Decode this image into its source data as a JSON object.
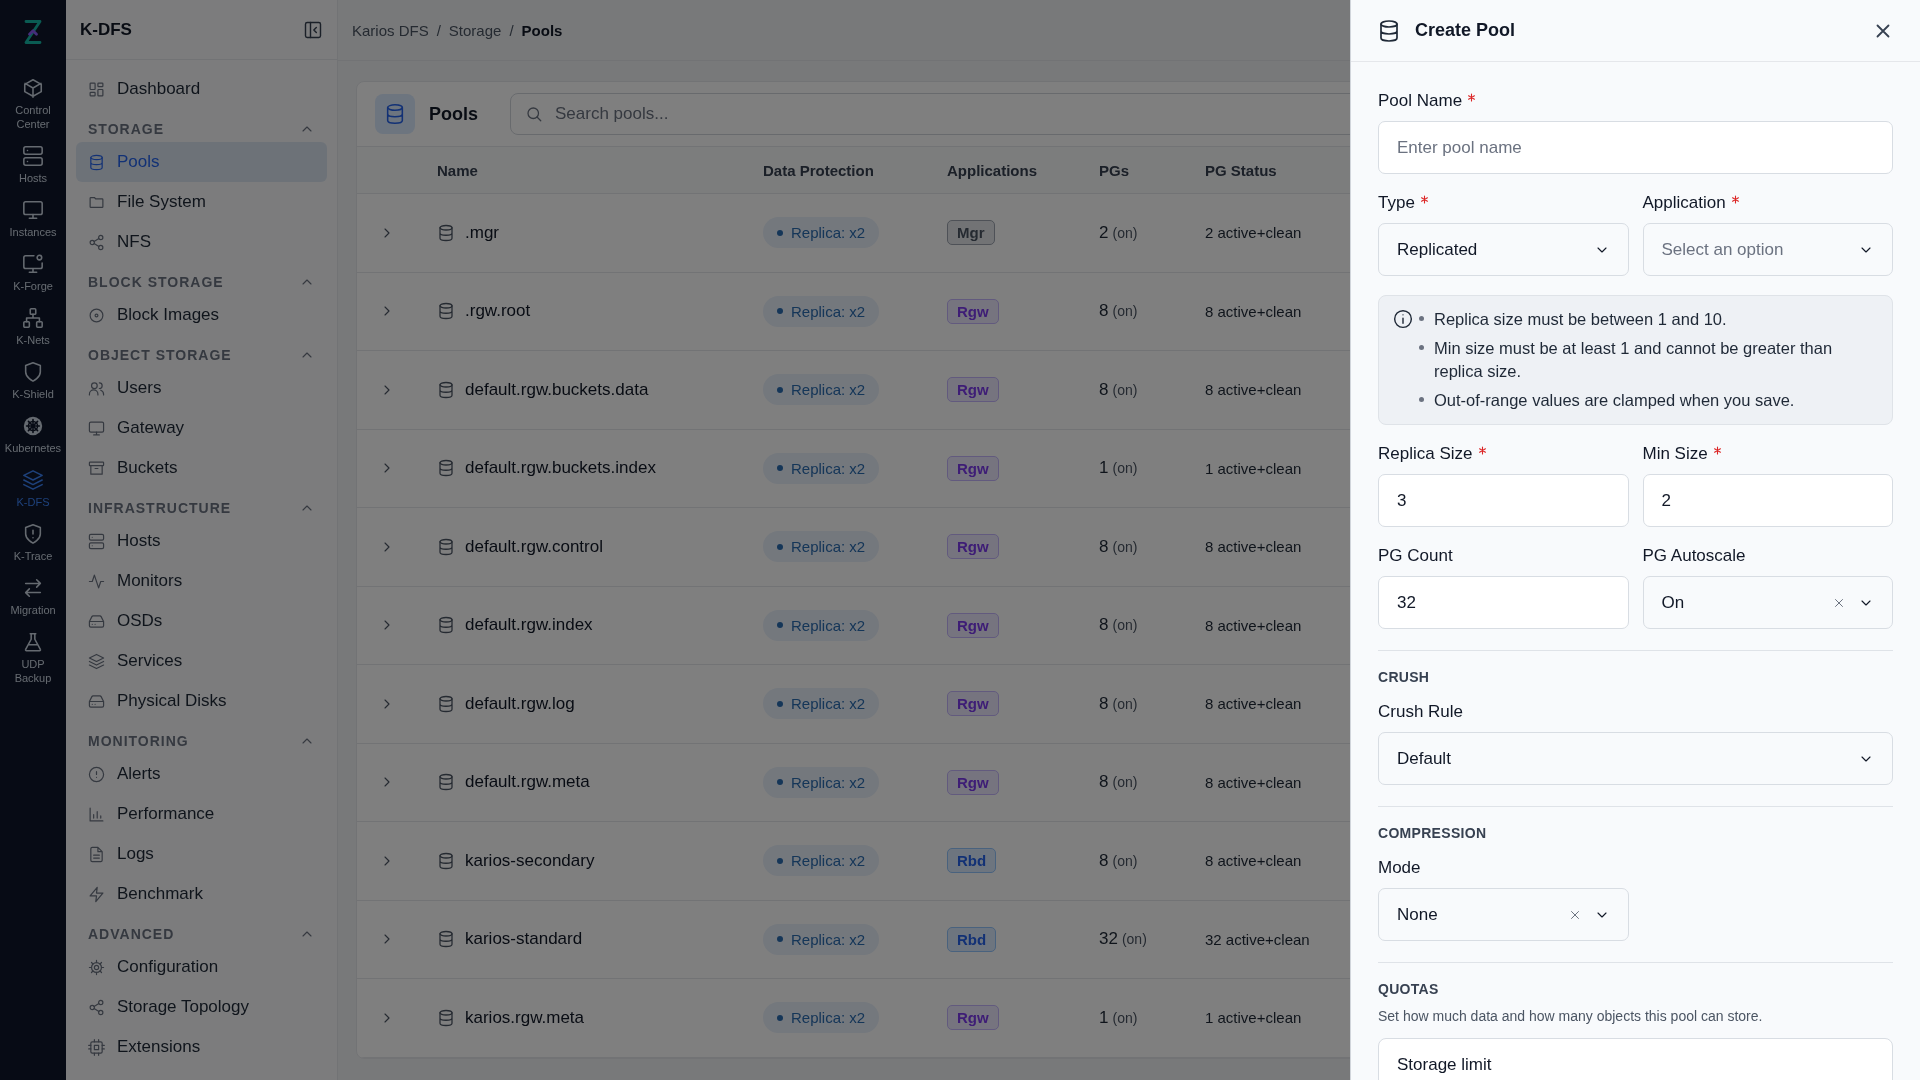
{
  "rail": {
    "items": [
      {
        "label": "Control Center",
        "selected": false
      },
      {
        "label": "Hosts",
        "selected": false
      },
      {
        "label": "Instances",
        "selected": false
      },
      {
        "label": "K-Forge",
        "selected": false
      },
      {
        "label": "K-Nets",
        "selected": false
      },
      {
        "label": "K-Shield",
        "selected": false
      },
      {
        "label": "Kubernetes",
        "selected": false
      },
      {
        "label": "K-DFS",
        "selected": true
      },
      {
        "label": "K-Trace",
        "selected": false
      },
      {
        "label": "Migration",
        "selected": false
      },
      {
        "label": "UDP Backup",
        "selected": false
      }
    ]
  },
  "sidebar": {
    "title": "K-DFS",
    "sections": [
      {
        "items": [
          {
            "label": "Dashboard",
            "selected": false
          }
        ]
      },
      {
        "heading": "STORAGE",
        "expanded": true,
        "items": [
          {
            "label": "Pools",
            "selected": true
          },
          {
            "label": "File System",
            "selected": false
          },
          {
            "label": "NFS",
            "selected": false
          }
        ]
      },
      {
        "heading": "BLOCK STORAGE",
        "expanded": true,
        "items": [
          {
            "label": "Block Images",
            "selected": false
          }
        ]
      },
      {
        "heading": "OBJECT STORAGE",
        "expanded": true,
        "items": [
          {
            "label": "Users",
            "selected": false
          },
          {
            "label": "Gateway",
            "selected": false
          },
          {
            "label": "Buckets",
            "selected": false
          }
        ]
      },
      {
        "heading": "INFRASTRUCTURE",
        "expanded": true,
        "items": [
          {
            "label": "Hosts",
            "selected": false
          },
          {
            "label": "Monitors",
            "selected": false
          },
          {
            "label": "OSDs",
            "selected": false
          },
          {
            "label": "Services",
            "selected": false
          },
          {
            "label": "Physical Disks",
            "selected": false
          }
        ]
      },
      {
        "heading": "MONITORING",
        "expanded": true,
        "items": [
          {
            "label": "Alerts",
            "selected": false
          },
          {
            "label": "Performance",
            "selected": false
          },
          {
            "label": "Logs",
            "selected": false
          },
          {
            "label": "Benchmark",
            "selected": false
          }
        ]
      },
      {
        "heading": "ADVANCED",
        "expanded": true,
        "items": [
          {
            "label": "Configuration",
            "selected": false
          },
          {
            "label": "Storage Topology",
            "selected": false
          },
          {
            "label": "Extensions",
            "selected": false
          }
        ]
      }
    ]
  },
  "breadcrumb": {
    "separator": "/",
    "items": [
      "Karios DFS",
      "Storage",
      "Pools"
    ]
  },
  "pools": {
    "title": "Pools",
    "search": {
      "placeholder": "Search pools..."
    },
    "columns": [
      "Name",
      "Data Protection",
      "Applications",
      "PGs",
      "PG Status"
    ],
    "rows": [
      {
        "name": ".mgr",
        "protection": "Replica: x2",
        "application": {
          "label": "Mgr",
          "kind": "mgr"
        },
        "pgs": "2",
        "pg_mode": "(on)",
        "pg_status": "2 active+clean"
      },
      {
        "name": ".rgw.root",
        "protection": "Replica: x2",
        "application": {
          "label": "Rgw",
          "kind": "rgw"
        },
        "pgs": "8",
        "pg_mode": "(on)",
        "pg_status": "8 active+clean"
      },
      {
        "name": "default.rgw.buckets.data",
        "protection": "Replica: x2",
        "application": {
          "label": "Rgw",
          "kind": "rgw"
        },
        "pgs": "8",
        "pg_mode": "(on)",
        "pg_status": "8 active+clean"
      },
      {
        "name": "default.rgw.buckets.index",
        "protection": "Replica: x2",
        "application": {
          "label": "Rgw",
          "kind": "rgw"
        },
        "pgs": "1",
        "pg_mode": "(on)",
        "pg_status": "1 active+clean"
      },
      {
        "name": "default.rgw.control",
        "protection": "Replica: x2",
        "application": {
          "label": "Rgw",
          "kind": "rgw"
        },
        "pgs": "8",
        "pg_mode": "(on)",
        "pg_status": "8 active+clean"
      },
      {
        "name": "default.rgw.index",
        "protection": "Replica: x2",
        "application": {
          "label": "Rgw",
          "kind": "rgw"
        },
        "pgs": "8",
        "pg_mode": "(on)",
        "pg_status": "8 active+clean"
      },
      {
        "name": "default.rgw.log",
        "protection": "Replica: x2",
        "application": {
          "label": "Rgw",
          "kind": "rgw"
        },
        "pgs": "8",
        "pg_mode": "(on)",
        "pg_status": "8 active+clean"
      },
      {
        "name": "default.rgw.meta",
        "protection": "Replica: x2",
        "application": {
          "label": "Rgw",
          "kind": "rgw"
        },
        "pgs": "8",
        "pg_mode": "(on)",
        "pg_status": "8 active+clean"
      },
      {
        "name": "karios-secondary",
        "protection": "Replica: x2",
        "application": {
          "label": "Rbd",
          "kind": "rbd"
        },
        "pgs": "8",
        "pg_mode": "(on)",
        "pg_status": "8 active+clean"
      },
      {
        "name": "karios-standard",
        "protection": "Replica: x2",
        "application": {
          "label": "Rbd",
          "kind": "rbd"
        },
        "pgs": "32",
        "pg_mode": "(on)",
        "pg_status": "32 active+clean"
      },
      {
        "name": "karios.rgw.meta",
        "protection": "Replica: x2",
        "application": {
          "label": "Rgw",
          "kind": "rgw"
        },
        "pgs": "1",
        "pg_mode": "(on)",
        "pg_status": "1 active+clean"
      }
    ]
  },
  "drawer": {
    "title": "Create Pool",
    "form": [
      {
        "kind": "row",
        "fields": [
          {
            "label": "Pool Name",
            "required": true,
            "kind": "input",
            "placeholder": "Enter pool name"
          }
        ]
      },
      {
        "kind": "row",
        "fields": [
          {
            "label": "Type",
            "required": true,
            "kind": "select",
            "value": "Replicated",
            "clearable": false
          },
          {
            "label": "Application",
            "required": true,
            "kind": "select",
            "placeholder": "Select an option",
            "clearable": false
          }
        ]
      },
      {
        "kind": "info",
        "items": [
          "Replica size must be between 1 and 10.",
          "Min size must be at least 1 and cannot be greater than replica size.",
          "Out-of-range values are clamped when you save."
        ]
      },
      {
        "kind": "row",
        "fields": [
          {
            "label": "Replica Size",
            "required": true,
            "kind": "input",
            "value": "3"
          },
          {
            "label": "Min Size",
            "required": true,
            "kind": "input",
            "value": "2"
          }
        ]
      },
      {
        "kind": "row",
        "fields": [
          {
            "label": "PG Count",
            "required": false,
            "kind": "input",
            "value": "32"
          },
          {
            "label": "PG Autoscale",
            "required": false,
            "kind": "select",
            "value": "On",
            "clearable": true
          }
        ]
      },
      {
        "kind": "section",
        "title": "CRUSH"
      },
      {
        "kind": "row",
        "fields": [
          {
            "label": "Crush Rule",
            "required": false,
            "kind": "select",
            "value": "Default",
            "clearable": false
          }
        ]
      },
      {
        "kind": "section",
        "title": "COMPRESSION"
      },
      {
        "kind": "row",
        "half": true,
        "fields": [
          {
            "label": "Mode",
            "required": false,
            "kind": "select",
            "value": "None",
            "clearable": true
          }
        ]
      },
      {
        "kind": "section",
        "title": "QUOTAS",
        "description": "Set how much data and how many objects this pool can store."
      },
      {
        "kind": "panel",
        "title": "Storage limit"
      }
    ]
  }
}
